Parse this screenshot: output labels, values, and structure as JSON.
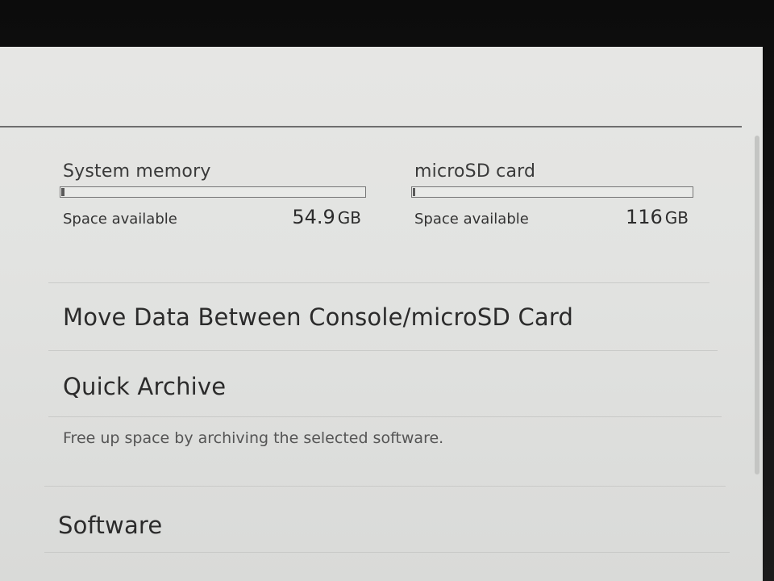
{
  "storage": {
    "system": {
      "title": "System memory",
      "label": "Space available",
      "value": "54.9",
      "unit": "GB",
      "used_fraction": 0.01
    },
    "sd": {
      "title": "microSD card",
      "label": "Space available",
      "value": "116",
      "unit": "GB",
      "used_fraction": 0.01
    }
  },
  "menu": {
    "move_data": "Move Data Between Console/microSD Card",
    "quick_archive": "Quick Archive",
    "quick_archive_desc": "Free up space by archiving the selected software.",
    "software": "Software"
  }
}
